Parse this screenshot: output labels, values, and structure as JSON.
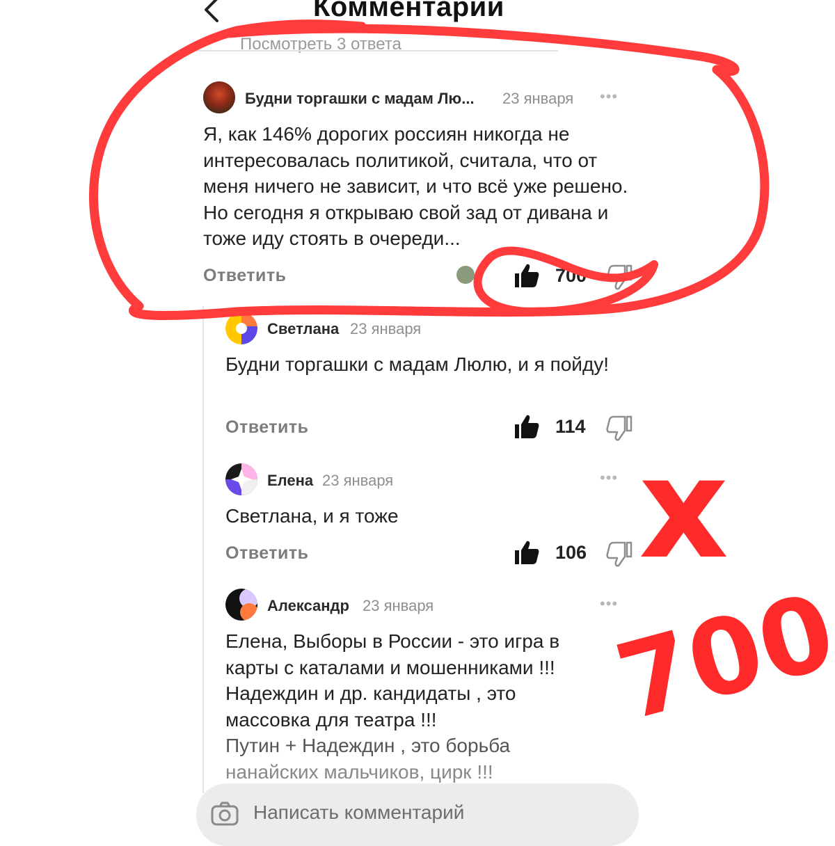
{
  "header": {
    "title": "Комментарии",
    "view_replies": "Посмотреть 3 ответа"
  },
  "comments": [
    {
      "author": "Будни торгашки с мадам Лю...",
      "date": "23 января",
      "text": "Я, как 146% дорогих россиян никогда не интересовалась политикой, считала, что от меня ничего не зависит, и что всё уже решено. Но сегодня я открываю свой зад от дивана и тоже иду стоять в очереди...",
      "reply_label": "Ответить",
      "likes": "700"
    },
    {
      "author": "Светлана",
      "date": "23 января",
      "text": "Будни торгашки с мадам Люлю, и я пойду!",
      "reply_label": "Ответить",
      "likes": "114"
    },
    {
      "author": "Елена",
      "date": "23 января",
      "text": "Светлана, и я тоже",
      "reply_label": "Ответить",
      "likes": "106"
    },
    {
      "author": "Александр",
      "date": "23 января",
      "text_lines": [
        "Елена, Выборы в России - это игра в",
        "карты с каталами и мошенниками !!!",
        "Надеждин  и др. кандидаты , это",
        "массовка для театра !!!",
        "Путин + Надеждин , это борьба",
        "нанайских мальчиков, цирк !!!"
      ]
    }
  ],
  "composer": {
    "placeholder": "Написать комментарий"
  },
  "annotation": {
    "text_x": "x",
    "text_count": "700",
    "color": "#ff2a2a"
  }
}
